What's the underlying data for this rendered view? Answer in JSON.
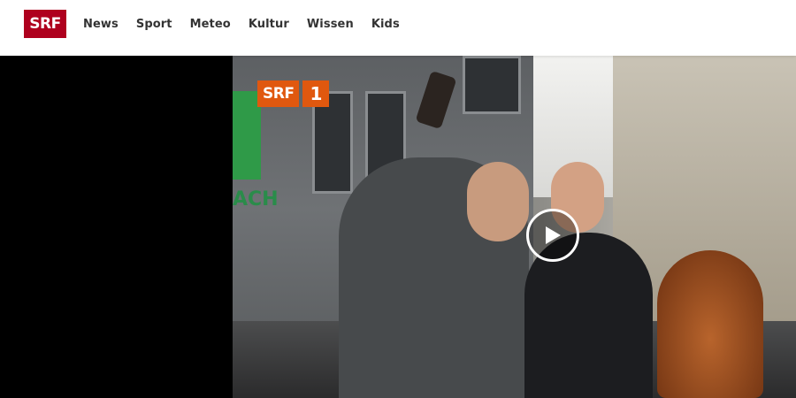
{
  "header": {
    "logo_text": "SRF",
    "logo_color": "#af001e",
    "nav": [
      "News",
      "Sport",
      "Meteo",
      "Kultur",
      "Wissen",
      "Kids"
    ]
  },
  "player": {
    "watermark_text": "SRF",
    "watermark_channel": "1",
    "watermark_color": "#e0580f",
    "play_icon": "play-icon",
    "sign_text": "ACH"
  }
}
